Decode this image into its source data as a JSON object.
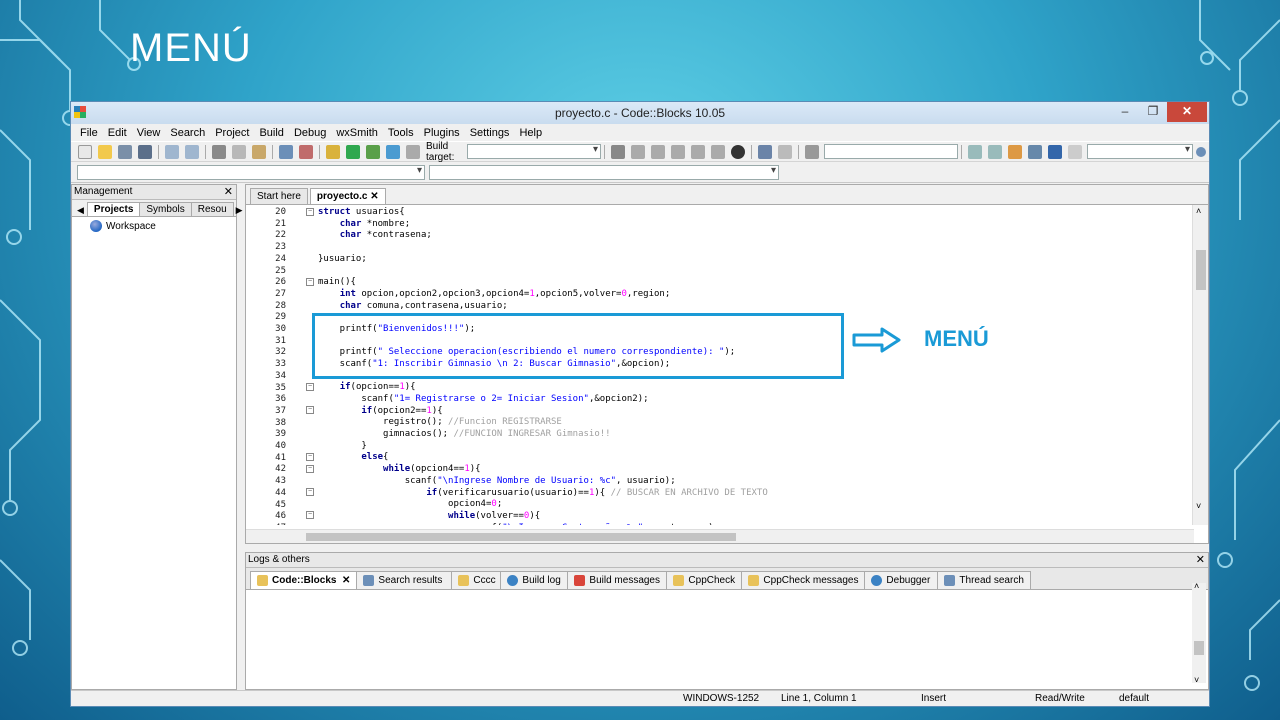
{
  "slide": {
    "title": "MENÚ",
    "annotation": "MENÚ"
  },
  "window": {
    "title": "proyecto.c - Code::Blocks 10.05",
    "controls": [
      "–",
      "❐",
      "✕"
    ]
  },
  "menu": [
    "File",
    "Edit",
    "View",
    "Search",
    "Project",
    "Build",
    "Debug",
    "wxSmith",
    "Tools",
    "Plugins",
    "Settings",
    "Help"
  ],
  "toolbar": {
    "build_target_label": "Build target:"
  },
  "management": {
    "title": "Management",
    "tabs": [
      "Projects",
      "Symbols",
      "Resou"
    ],
    "workspace": "Workspace"
  },
  "editor": {
    "tabs": [
      "Start here",
      "proyecto.c"
    ],
    "line_numbers": [
      "20",
      "21",
      "22",
      "23",
      "24",
      "25",
      "26",
      "27",
      "28",
      "29",
      "30",
      "31",
      "32",
      "33",
      "34",
      "35",
      "36",
      "37",
      "38",
      "39",
      "40",
      "41",
      "42",
      "43",
      "44",
      "45",
      "46",
      "47"
    ]
  },
  "logs": {
    "title": "Logs & others",
    "tabs": [
      "Code::Blocks",
      "Search results",
      "Cccc",
      "Build log",
      "Build messages",
      "CppCheck",
      "CppCheck messages",
      "Debugger",
      "Thread search"
    ]
  },
  "status": {
    "encoding": "WINDOWS-1252",
    "position": "Line 1, Column 1",
    "mode": "Insert",
    "access": "Read/Write",
    "lang": "default"
  },
  "colors": {
    "accent": "#1a9ad6",
    "close_button": "#c9483b"
  }
}
